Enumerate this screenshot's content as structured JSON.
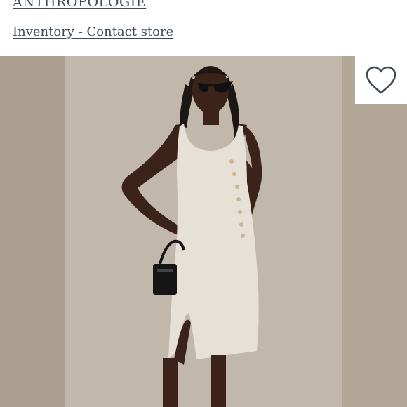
{
  "header": {
    "brand": "ANTHROPOLOGIE",
    "inventory_link": "Inventory - Contact store"
  },
  "product": {
    "favorite_icon": "heart-outline-icon",
    "image_subject": "model-wearing-white-button-midi-dress"
  },
  "colors": {
    "link": "#3d4a5a",
    "image_background": "#b3a898",
    "dress": "#e6e0d6",
    "heart_stroke": "#3d4a5a"
  }
}
